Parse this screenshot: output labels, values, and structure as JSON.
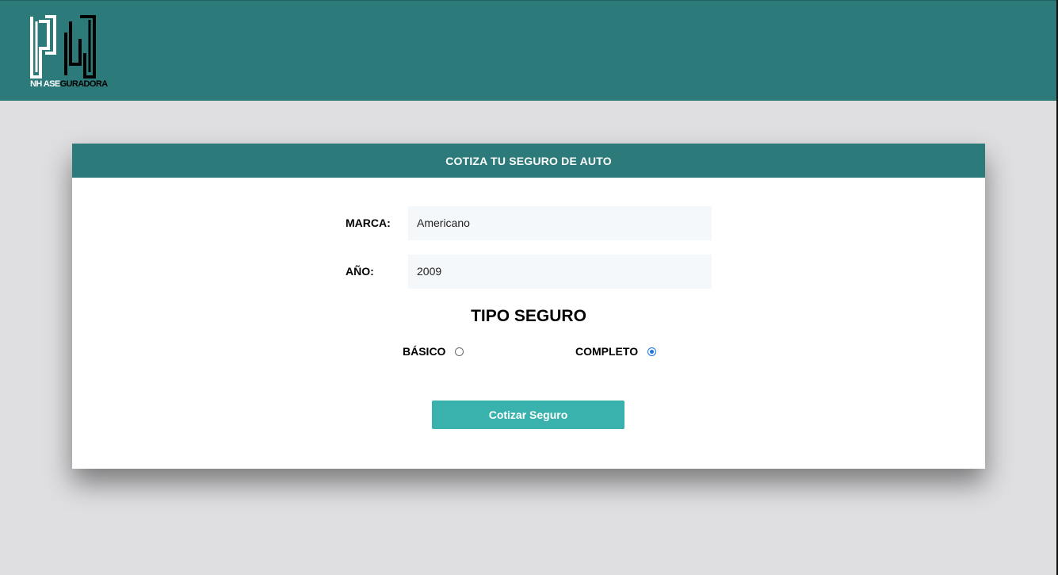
{
  "header": {
    "logo": {
      "text_light": "NH ASE",
      "text_dark": "GURADORA",
      "icon": "nh-monogram-logo"
    }
  },
  "card": {
    "title": "COTIZA TU SEGURO DE AUTO",
    "fields": {
      "marca": {
        "label": "MARCA:",
        "value": "Americano"
      },
      "anio": {
        "label": "AÑO:",
        "value": "2009"
      }
    },
    "tipo_seguro": {
      "heading": "TIPO SEGURO",
      "options": [
        {
          "label": "BÁSICO",
          "checked": false
        },
        {
          "label": "COMPLETO",
          "checked": true
        }
      ]
    },
    "submit_label": "Cotizar Seguro"
  },
  "colors": {
    "primary": "#2d7a7b",
    "button": "#39b1ac",
    "background": "#dfdfe1",
    "input_bg": "#f5f8fb"
  }
}
